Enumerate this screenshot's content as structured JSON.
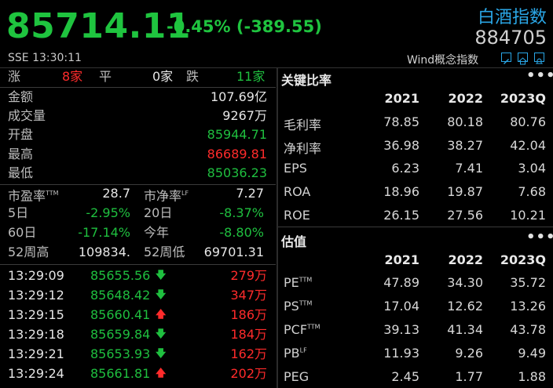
{
  "header": {
    "price": "85714.11",
    "change": "-0.45% (-389.55)",
    "index_name": "白酒指数",
    "code": "884705",
    "exchange_time": "SSE  13:30:11",
    "concept": "Wind概念指数",
    "icons": [
      "edit-icon",
      "home-icon",
      "bell-icon"
    ]
  },
  "breadth": {
    "up_label": "涨",
    "up_count": "8家",
    "flat_label": "平",
    "flat_count": "0家",
    "down_label": "跌",
    "down_count": "11家"
  },
  "stats": [
    {
      "label": "金额",
      "value": "107.69亿"
    },
    {
      "label": "成交量",
      "value": "9267万"
    },
    {
      "label": "开盘",
      "value": "85944.71"
    },
    {
      "label": "最高",
      "value": "86689.81"
    },
    {
      "label": "最低",
      "value": "85036.23"
    }
  ],
  "valuation": {
    "pe_label": "市盈率",
    "pe_sup": "TTM",
    "pe_value": "28.7",
    "pb_label": "市净率",
    "pb_sup": "LF",
    "pb_value": "7.27"
  },
  "returns": [
    {
      "l1": "5日",
      "v1": "-2.95%",
      "l2": "20日",
      "v2": "-8.37%"
    },
    {
      "l1": "60日",
      "v1": "-17.14%",
      "l2": "今年",
      "v2": "-8.80%"
    },
    {
      "l1": "52周高",
      "v1": "109834.",
      "l2": "52周低",
      "v2": "69701.31"
    }
  ],
  "ticks": [
    {
      "time": "13:29:09",
      "price": "85655.56",
      "dir": "down",
      "vol": "279万"
    },
    {
      "time": "13:29:12",
      "price": "85648.42",
      "dir": "down",
      "vol": "347万"
    },
    {
      "time": "13:29:15",
      "price": "85660.41",
      "dir": "up",
      "vol": "186万"
    },
    {
      "time": "13:29:18",
      "price": "85659.84",
      "dir": "down",
      "vol": "184万"
    },
    {
      "time": "13:29:21",
      "price": "85653.93",
      "dir": "down",
      "vol": "162万"
    },
    {
      "time": "13:29:24",
      "price": "85661.81",
      "dir": "up",
      "vol": "202万"
    }
  ],
  "key_ratios": {
    "title": "关键比率",
    "more": "•••",
    "years": [
      "2021",
      "2022",
      "2023Q"
    ],
    "rows": [
      {
        "label": "毛利率",
        "sup": "",
        "values": [
          "78.85",
          "80.18",
          "80.76"
        ]
      },
      {
        "label": "净利率",
        "sup": "",
        "values": [
          "36.98",
          "38.27",
          "42.04"
        ]
      },
      {
        "label": "EPS",
        "sup": "",
        "values": [
          "6.23",
          "7.41",
          "3.04"
        ]
      },
      {
        "label": "ROA",
        "sup": "",
        "values": [
          "18.96",
          "19.87",
          "7.68"
        ]
      },
      {
        "label": "ROE",
        "sup": "",
        "values": [
          "26.15",
          "27.56",
          "10.21"
        ]
      }
    ]
  },
  "valuation_table": {
    "title": "估值",
    "more": "•••",
    "years": [
      "2021",
      "2022",
      "2023Q"
    ],
    "rows": [
      {
        "label": "PE",
        "sup": "TTM",
        "values": [
          "47.89",
          "34.30",
          "35.72"
        ]
      },
      {
        "label": "PS",
        "sup": "TTM",
        "values": [
          "17.04",
          "12.62",
          "13.26"
        ]
      },
      {
        "label": "PCF",
        "sup": "TTM",
        "values": [
          "39.13",
          "41.34",
          "43.78"
        ]
      },
      {
        "label": "PB",
        "sup": "LF",
        "values": [
          "11.93",
          "9.26",
          "9.49"
        ]
      },
      {
        "label": "PEG",
        "sup": "",
        "values": [
          "2.45",
          "1.77",
          "1.88"
        ]
      }
    ]
  },
  "colors": {
    "up": "#ff2b2b",
    "down": "#1fbf3f",
    "accent": "#2aa6e6"
  }
}
